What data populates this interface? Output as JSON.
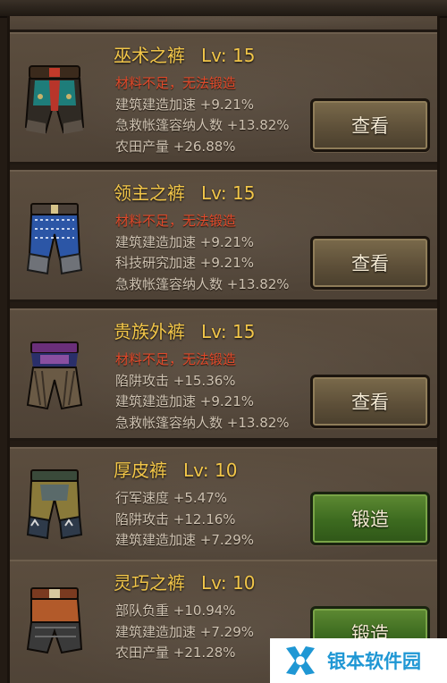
{
  "items": [
    {
      "name": "巫术之裤",
      "level": "Lv: 15",
      "stats": [
        "材料不足，无法锻造",
        "建筑建造加速 +9.21%",
        "急救帐篷容纳人数 +13.82%",
        "农田产量 +26.88%"
      ],
      "warning": true,
      "action": "查看",
      "icon": "witchcraft-pants-icon"
    },
    {
      "name": "领主之裤",
      "level": "Lv: 15",
      "stats": [
        "材料不足，无法锻造",
        "建筑建造加速 +9.21%",
        "科技研究加速 +9.21%",
        "急救帐篷容纳人数 +13.82%"
      ],
      "warning": true,
      "action": "查看",
      "icon": "lord-pants-icon"
    },
    {
      "name": "贵族外裤",
      "level": "Lv: 15",
      "stats": [
        "材料不足，无法锻造",
        "陷阱攻击 +15.36%",
        "建筑建造加速 +9.21%",
        "急救帐篷容纳人数 +13.82%"
      ],
      "warning": true,
      "action": "查看",
      "icon": "noble-pants-icon"
    },
    {
      "name": "厚皮裤",
      "level": "Lv: 10",
      "stats": [
        "行军速度 +5.47%",
        "陷阱攻击 +12.16%",
        "建筑建造加速 +7.29%"
      ],
      "warning": false,
      "action": "锻造",
      "icon": "thick-leather-pants-icon"
    },
    {
      "name": "灵巧之裤",
      "level": "Lv: 10",
      "stats": [
        "部队负重 +10.94%",
        "建筑建造加速 +7.29%",
        "农田产量 +21.28%"
      ],
      "warning": false,
      "action": "锻造",
      "icon": "agile-pants-icon"
    }
  ],
  "watermark": {
    "text": "银本软件园",
    "icon": "x-logo-icon",
    "color": "#1f97d4"
  },
  "colors": {
    "title": "#f2c649",
    "warning": "#e0492a",
    "stat": "#cfc3b2",
    "view_button": "#5e5039",
    "forge_button": "#3c6a1f"
  }
}
